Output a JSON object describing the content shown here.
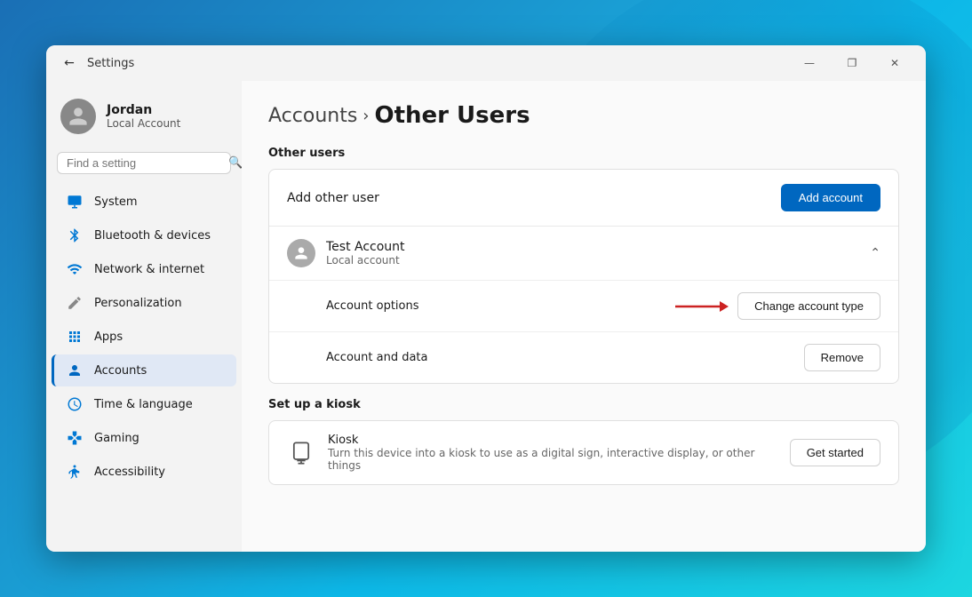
{
  "window": {
    "title": "Settings",
    "controls": {
      "minimize": "—",
      "maximize": "❐",
      "close": "✕"
    }
  },
  "sidebar": {
    "user": {
      "name": "Jordan",
      "account_type": "Local Account"
    },
    "search": {
      "placeholder": "Find a setting"
    },
    "nav_items": [
      {
        "id": "system",
        "label": "System",
        "icon": "monitor"
      },
      {
        "id": "bluetooth",
        "label": "Bluetooth & devices",
        "icon": "bluetooth"
      },
      {
        "id": "network",
        "label": "Network & internet",
        "icon": "network"
      },
      {
        "id": "personalization",
        "label": "Personalization",
        "icon": "pen"
      },
      {
        "id": "apps",
        "label": "Apps",
        "icon": "apps"
      },
      {
        "id": "accounts",
        "label": "Accounts",
        "icon": "accounts",
        "active": true
      },
      {
        "id": "time",
        "label": "Time & language",
        "icon": "time"
      },
      {
        "id": "gaming",
        "label": "Gaming",
        "icon": "gaming"
      },
      {
        "id": "accessibility",
        "label": "Accessibility",
        "icon": "accessibility"
      }
    ]
  },
  "main": {
    "breadcrumb": {
      "parent": "Accounts",
      "arrow": "›",
      "current": "Other Users"
    },
    "other_users_label": "Other users",
    "add_user_row": {
      "label": "Add other user",
      "button": "Add account"
    },
    "test_account": {
      "name": "Test Account",
      "sub": "Local account",
      "options_label": "Account options",
      "change_type_button": "Change account type",
      "data_label": "Account and data",
      "remove_button": "Remove"
    },
    "kiosk": {
      "section_label": "Set up a kiosk",
      "name": "Kiosk",
      "description": "Turn this device into a kiosk to use as a digital sign, interactive display, or other things",
      "button": "Get started"
    }
  }
}
